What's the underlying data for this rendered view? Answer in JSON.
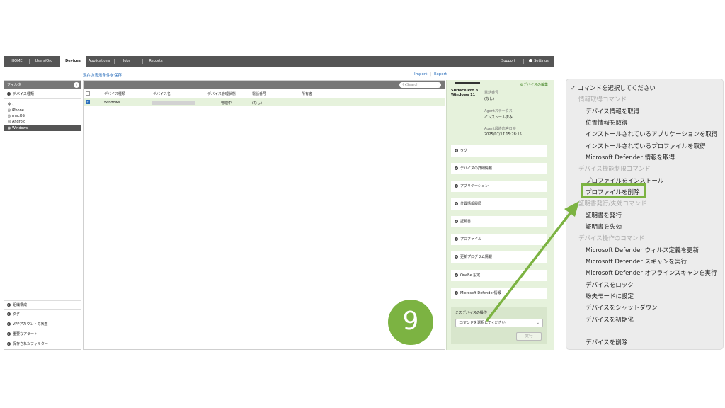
{
  "nav": {
    "items": [
      "HOME",
      "Users/Org",
      "Devices",
      "Applications",
      "Jobs",
      "Reports"
    ],
    "support": "Support",
    "settings": "Settings"
  },
  "sublinks": {
    "save_filter": "現在の表示条件を保存",
    "import": "Import",
    "sep": "|",
    "export": "Export"
  },
  "filter": {
    "title": "フィルター",
    "device_type_section": "デバイス種類",
    "options": [
      "全て",
      "iPhone",
      "macOS",
      "Android",
      "Windows"
    ],
    "bottom_sections": [
      "組織構成",
      "タグ",
      "VPPアカウントの状態",
      "重要なアラート",
      "保存されたフィルター"
    ]
  },
  "list": {
    "search_placeholder": "Search",
    "columns": [
      "デバイス種類",
      "デバイス名",
      "デバイス管理状態",
      "電話番号",
      "所有者"
    ],
    "row": {
      "type": "Windows",
      "state": "管理中",
      "phone": "(なし)"
    }
  },
  "detail": {
    "edit": "デバイスの編集",
    "device_name_line1": "Surface Pro 8",
    "device_name_line2": "Windows 11",
    "phone_label": "電話番号",
    "phone_value": "(なし)",
    "agent_status_label": "Agentステータス",
    "agent_status_value": "インストール済み",
    "agent_last_label": "Agent最終応答日時",
    "agent_last_value": "2025/07/17 15:28:15",
    "sections": [
      "タグ",
      "デバイスの詳細情報",
      "アプリケーション",
      "位置情報履歴",
      "証明書",
      "プロファイル",
      "更新プログラム情報",
      "OneBe 設定",
      "Microsoft Defender情報"
    ],
    "cmd_label": "このデバイスの操作",
    "cmd_select": "コマンドを選択してください",
    "exec": "実行"
  },
  "menu": {
    "selected": "✓ コマンドを選択してください",
    "items": [
      {
        "t": "情報取得コマンド",
        "hdr": true
      },
      {
        "t": "デバイス情報を取得"
      },
      {
        "t": "位置情報を取得"
      },
      {
        "t": "インストールされているアプリケーションを取得"
      },
      {
        "t": "インストールされているプロファイルを取得"
      },
      {
        "t": "Microsoft Defender 情報を取得"
      },
      {
        "t": "デバイス機能制限コマンド",
        "hdr": true
      },
      {
        "t": "プロファイルをインストール"
      },
      {
        "t": "プロファイルを削除"
      },
      {
        "t": "証明書発行/失効コマンド",
        "hdr": true
      },
      {
        "t": "証明書を発行"
      },
      {
        "t": "証明書を失効"
      },
      {
        "t": "デバイス操作のコマンド",
        "hdr": true
      },
      {
        "t": "Microsoft Defender ウィルス定義を更新"
      },
      {
        "t": "Microsoft Defender スキャンを実行"
      },
      {
        "t": "Microsoft Defender オフラインスキャンを実行"
      },
      {
        "t": "デバイスをロック"
      },
      {
        "t": "紛失モードに設定"
      },
      {
        "t": "デバイスをシャットダウン"
      },
      {
        "t": "デバイスを初期化"
      },
      {
        "t": "デバイスを削除"
      }
    ]
  },
  "step": "9",
  "colors": {
    "accent_green": "#7cb342",
    "nav_bg": "#555555",
    "link_blue": "#2a6ebb"
  }
}
